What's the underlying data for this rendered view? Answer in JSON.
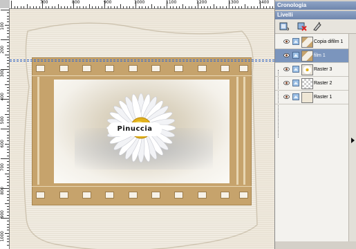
{
  "rulers": {
    "top_labels": [
      "700",
      "800",
      "900",
      "1000",
      "1100",
      "1200",
      "1300",
      "1400"
    ],
    "left_labels": [
      "100",
      "200",
      "300",
      "400",
      "500",
      "600",
      "700",
      "800",
      "900",
      "1000"
    ]
  },
  "canvas": {
    "photo_label": "Pinuccia"
  },
  "panels": {
    "history_title": "Cronologia",
    "layers_title": "Livelli"
  },
  "layers": [
    {
      "name": "Copia difilm 1",
      "selected": false,
      "thumb": "film"
    },
    {
      "name": "film 1",
      "selected": true,
      "thumb": "film"
    },
    {
      "name": "Raster 3",
      "selected": false,
      "thumb": "flower"
    },
    {
      "name": "Raster 2",
      "selected": false,
      "thumb": "checker"
    },
    {
      "name": "Raster 1",
      "selected": false,
      "thumb": "cream"
    }
  ],
  "colors": {
    "panel_header": "#7a8fb6",
    "selected_layer": "#7b95bd",
    "film": "#c6a36c",
    "guide": "#3f6fc8"
  },
  "icons": [
    "eye-icon",
    "layer-raster-icon",
    "new-layer-icon",
    "delete-layer-icon",
    "mask-icon"
  ]
}
